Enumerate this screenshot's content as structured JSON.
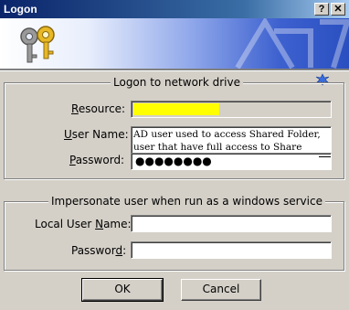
{
  "window": {
    "title": "Logon",
    "help_glyph": "?",
    "close_glyph": "✕"
  },
  "group1": {
    "legend": "Logon to network drive",
    "resource_label_pre": "",
    "resource_label_ul": "R",
    "resource_label_post": "esource:",
    "resource_value": "",
    "username_label_pre": "",
    "username_label_ul": "U",
    "username_label_post": "ser Name:",
    "username_value": "AD user used to access Shared Folder, user that have full access to Share folder",
    "password_label_pre": "",
    "password_label_ul": "P",
    "password_label_post": "assword:",
    "password_value": "●●●●●●●●"
  },
  "group2": {
    "legend": "Impersonate user when run as a windows service",
    "local_user_label_pre": "Local User ",
    "local_user_label_ul": "N",
    "local_user_label_post": "ame:",
    "local_user_value": "",
    "password_label_pre": "Passwor",
    "password_label_ul": "d",
    "password_label_post": ":",
    "password_value": ""
  },
  "buttons": {
    "ok": "OK",
    "cancel": "Cancel"
  },
  "colors": {
    "title_bar": "#0a246a",
    "highlight": "#ffff00",
    "face": "#d4d0c8"
  }
}
